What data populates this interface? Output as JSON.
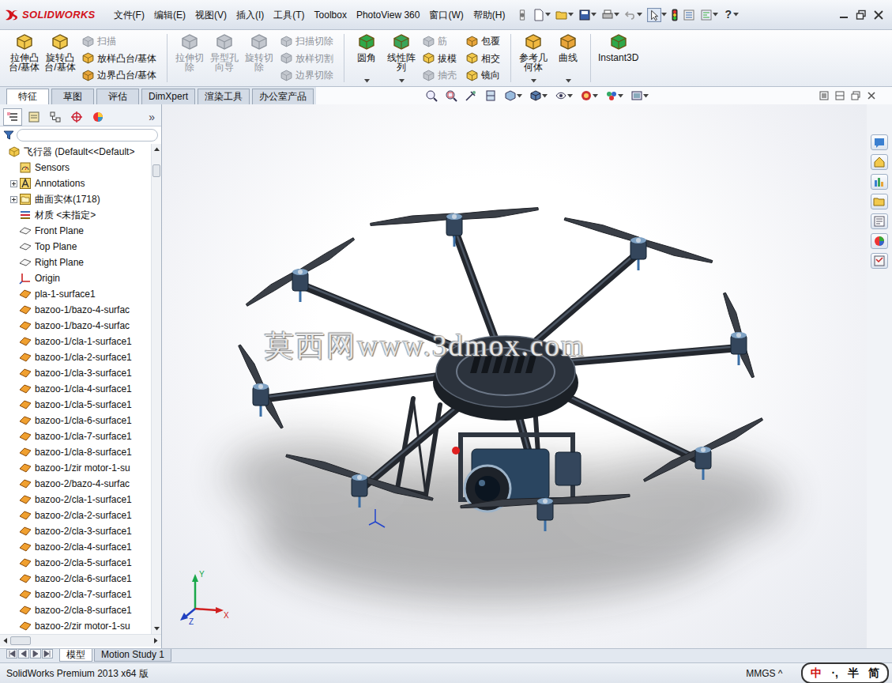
{
  "window": {
    "logo": "SOLIDWORKS",
    "menus": [
      "文件(F)",
      "编辑(E)",
      "视图(V)",
      "插入(I)",
      "工具(T)",
      "Toolbox",
      "PhotoView 360",
      "窗口(W)",
      "帮助(H)"
    ],
    "help": "?"
  },
  "ribbon": [
    {
      "kind": "large",
      "items": [
        {
          "label": "拉伸凸\n台/基体",
          "disabled": false,
          "dropdown": false
        }
      ]
    },
    {
      "kind": "large",
      "items": [
        {
          "label": "旋转凸\n台/基体",
          "disabled": false,
          "dropdown": false
        }
      ]
    },
    {
      "kind": "stack",
      "items": [
        {
          "label": "扫描",
          "disabled": true,
          "dropdown": false
        },
        {
          "label": "放样凸台/基体",
          "disabled": false,
          "dropdown": false
        },
        {
          "label": "边界凸台/基体",
          "disabled": false,
          "dropdown": false
        }
      ]
    },
    {
      "kind": "separator",
      "items": []
    },
    {
      "kind": "large",
      "items": [
        {
          "label": "拉伸切\n除",
          "disabled": true,
          "dropdown": false
        }
      ]
    },
    {
      "kind": "large",
      "items": [
        {
          "label": "异型孔\n向导",
          "disabled": true,
          "dropdown": false
        }
      ]
    },
    {
      "kind": "large",
      "items": [
        {
          "label": "旋转切\n除",
          "disabled": true,
          "dropdown": false
        }
      ]
    },
    {
      "kind": "stack",
      "items": [
        {
          "label": "扫描切除",
          "disabled": true,
          "dropdown": false
        },
        {
          "label": "放样切割",
          "disabled": true,
          "dropdown": false
        },
        {
          "label": "边界切除",
          "disabled": true,
          "dropdown": false
        }
      ]
    },
    {
      "kind": "separator",
      "items": []
    },
    {
      "kind": "large",
      "items": [
        {
          "label": "圆角",
          "disabled": false,
          "dropdown": true
        }
      ]
    },
    {
      "kind": "large",
      "items": [
        {
          "label": "线性阵\n列",
          "disabled": false,
          "dropdown": true
        }
      ]
    },
    {
      "kind": "stack",
      "items": [
        {
          "label": "筋",
          "disabled": true,
          "dropdown": false
        },
        {
          "label": "拔模",
          "disabled": false,
          "dropdown": false
        },
        {
          "label": "抽壳",
          "disabled": true,
          "dropdown": false
        }
      ]
    },
    {
      "kind": "stack",
      "items": [
        {
          "label": "包覆",
          "disabled": false,
          "dropdown": false
        },
        {
          "label": "相交",
          "disabled": false,
          "dropdown": false
        },
        {
          "label": "镜向",
          "disabled": false,
          "dropdown": false
        }
      ]
    },
    {
      "kind": "separator",
      "items": []
    },
    {
      "kind": "large",
      "items": [
        {
          "label": "参考几\n何体",
          "disabled": false,
          "dropdown": true
        }
      ]
    },
    {
      "kind": "large",
      "items": [
        {
          "label": "曲线",
          "disabled": false,
          "dropdown": true
        }
      ]
    },
    {
      "kind": "separator",
      "items": []
    },
    {
      "kind": "large",
      "items": [
        {
          "label": "Instant3D",
          "disabled": false,
          "dropdown": false
        }
      ]
    }
  ],
  "command_tabs": [
    {
      "label": "特征",
      "selected": true
    },
    {
      "label": "草图",
      "selected": false
    },
    {
      "label": "评估",
      "selected": false
    },
    {
      "label": "DimXpert",
      "selected": false
    },
    {
      "label": "渲染工具",
      "selected": false
    },
    {
      "label": "办公室产品",
      "selected": false
    }
  ],
  "sidebar": {
    "panel_tabs": [
      {
        "selected": true
      },
      {
        "selected": false
      },
      {
        "selected": false
      },
      {
        "selected": false
      },
      {
        "selected": false
      }
    ],
    "more": "»",
    "scroll_level": 0.02,
    "items": [
      {
        "label": "飞行器 (Default<<Default>",
        "kind": "root",
        "expandable": false,
        "expanded": false
      },
      {
        "label": "Sensors",
        "kind": "sensors",
        "expandable": false,
        "expanded": false
      },
      {
        "label": "Annotations",
        "kind": "annotations",
        "expandable": true,
        "expanded": false
      },
      {
        "label": "曲面实体(1718)",
        "kind": "folder",
        "expandable": true,
        "expanded": false
      },
      {
        "label": "材质 <未指定>",
        "kind": "material",
        "expandable": false,
        "expanded": false
      },
      {
        "label": "Front Plane",
        "kind": "plane",
        "expandable": false,
        "expanded": false
      },
      {
        "label": "Top Plane",
        "kind": "plane",
        "expandable": false,
        "expanded": false
      },
      {
        "label": "Right Plane",
        "kind": "plane",
        "expandable": false,
        "expanded": false
      },
      {
        "label": "Origin",
        "kind": "origin",
        "expandable": false,
        "expanded": false
      },
      {
        "label": "pla-1-surface1",
        "kind": "surface",
        "expandable": false,
        "expanded": false
      },
      {
        "label": "bazoo-1/bazo-4-surfac",
        "kind": "surface",
        "expandable": false,
        "expanded": false
      },
      {
        "label": "bazoo-1/bazo-4-surfac",
        "kind": "surface",
        "expandable": false,
        "expanded": false
      },
      {
        "label": "bazoo-1/cla-1-surface1",
        "kind": "surface",
        "expandable": false,
        "expanded": false
      },
      {
        "label": "bazoo-1/cla-2-surface1",
        "kind": "surface",
        "expandable": false,
        "expanded": false
      },
      {
        "label": "bazoo-1/cla-3-surface1",
        "kind": "surface",
        "expandable": false,
        "expanded": false
      },
      {
        "label": "bazoo-1/cla-4-surface1",
        "kind": "surface",
        "expandable": false,
        "expanded": false
      },
      {
        "label": "bazoo-1/cla-5-surface1",
        "kind": "surface",
        "expandable": false,
        "expanded": false
      },
      {
        "label": "bazoo-1/cla-6-surface1",
        "kind": "surface",
        "expandable": false,
        "expanded": false
      },
      {
        "label": "bazoo-1/cla-7-surface1",
        "kind": "surface",
        "expandable": false,
        "expanded": false
      },
      {
        "label": "bazoo-1/cla-8-surface1",
        "kind": "surface",
        "expandable": false,
        "expanded": false
      },
      {
        "label": "bazoo-1/zir motor-1-su",
        "kind": "surface",
        "expandable": false,
        "expanded": false
      },
      {
        "label": "bazoo-2/bazo-4-surfac",
        "kind": "surface",
        "expandable": false,
        "expanded": false
      },
      {
        "label": "bazoo-2/cla-1-surface1",
        "kind": "surface",
        "expandable": false,
        "expanded": false
      },
      {
        "label": "bazoo-2/cla-2-surface1",
        "kind": "surface",
        "expandable": false,
        "expanded": false
      },
      {
        "label": "bazoo-2/cla-3-surface1",
        "kind": "surface",
        "expandable": false,
        "expanded": false
      },
      {
        "label": "bazoo-2/cla-4-surface1",
        "kind": "surface",
        "expandable": false,
        "expanded": false
      },
      {
        "label": "bazoo-2/cla-5-surface1",
        "kind": "surface",
        "expandable": false,
        "expanded": false
      },
      {
        "label": "bazoo-2/cla-6-surface1",
        "kind": "surface",
        "expandable": false,
        "expanded": false
      },
      {
        "label": "bazoo-2/cla-7-surface1",
        "kind": "surface",
        "expandable": false,
        "expanded": false
      },
      {
        "label": "bazoo-2/cla-8-surface1",
        "kind": "surface",
        "expandable": false,
        "expanded": false
      },
      {
        "label": "bazoo-2/zir motor-1-su",
        "kind": "surface",
        "expandable": false,
        "expanded": false
      }
    ]
  },
  "viewport": {
    "watermark": "莫西网www.3dmox.com",
    "triad": [
      "Y",
      "X",
      "Z"
    ]
  },
  "model_tabs": [
    {
      "label": "模型",
      "selected": true
    },
    {
      "label": "Motion Study 1",
      "selected": false
    }
  ],
  "status_bar": {
    "product": "SolidWorks Premium 2013 x64 版",
    "units": "MMGS ^",
    "ime": [
      "中",
      "·,",
      "半",
      "简"
    ]
  }
}
